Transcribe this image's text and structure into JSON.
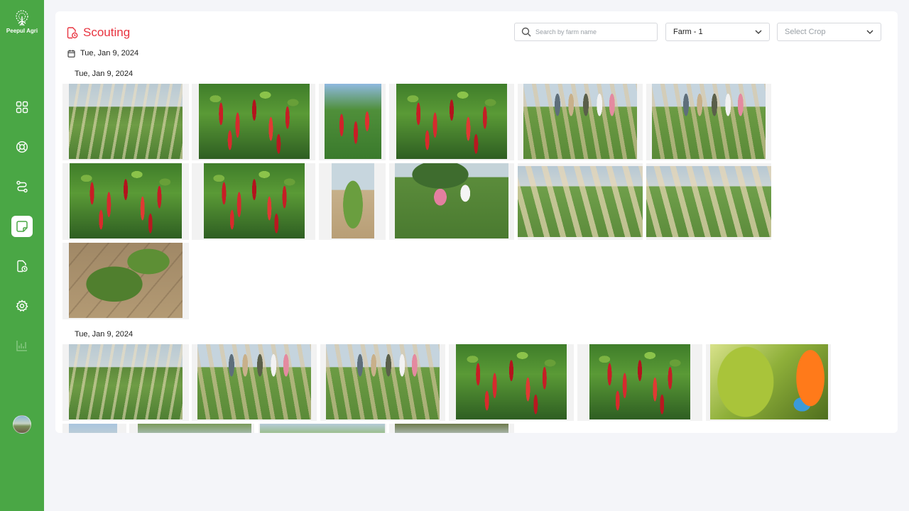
{
  "app": {
    "brand_name": "Peepul Agri"
  },
  "sidebar": {
    "items": [
      {
        "icon": "dashboard-grid-icon"
      },
      {
        "icon": "lifebuoy-icon"
      },
      {
        "icon": "route-icon"
      },
      {
        "icon": "scouting-notes-icon",
        "active": true
      },
      {
        "icon": "file-clock-icon"
      },
      {
        "icon": "gear-icon"
      },
      {
        "icon": "analytics-chart-icon",
        "disabled": true
      }
    ],
    "avatar": "user-avatar"
  },
  "page": {
    "title": "Scouting",
    "date": "Tue, Jan 9, 2024"
  },
  "filters": {
    "search_placeholder": "Search by farm name",
    "farm_selected": "Farm - 1",
    "crop_placeholder": "Select Crop"
  },
  "groups": [
    {
      "date": "Tue, Jan 9, 2024",
      "photo_count_visible": 13
    },
    {
      "date": "Tue, Jan 9, 2024",
      "photo_count_visible": 10
    }
  ],
  "colors": {
    "sidebar_bg": "#4aa745",
    "title_red": "#e8333f"
  }
}
